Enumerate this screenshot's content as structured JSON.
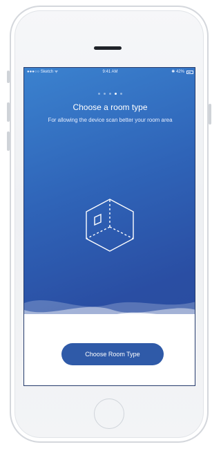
{
  "status_bar": {
    "carrier": "●●●○○ Sketch ᯤ",
    "time": "9:41 AM",
    "battery_text": "✱ 42%"
  },
  "pager": {
    "count": 5,
    "active_index": 3
  },
  "onboarding": {
    "title": "Choose a room type",
    "subtitle": "For allowing the device scan better your room area"
  },
  "cta": {
    "label": "Choose Room Type"
  },
  "icons": {
    "illustration": "room-cube-icon",
    "home": "home-button"
  },
  "colors": {
    "gradient_top": "#3b82cf",
    "gradient_bottom": "#2a4b9d",
    "button": "#2f5aa8",
    "phone_body": "#f3f4f6"
  }
}
